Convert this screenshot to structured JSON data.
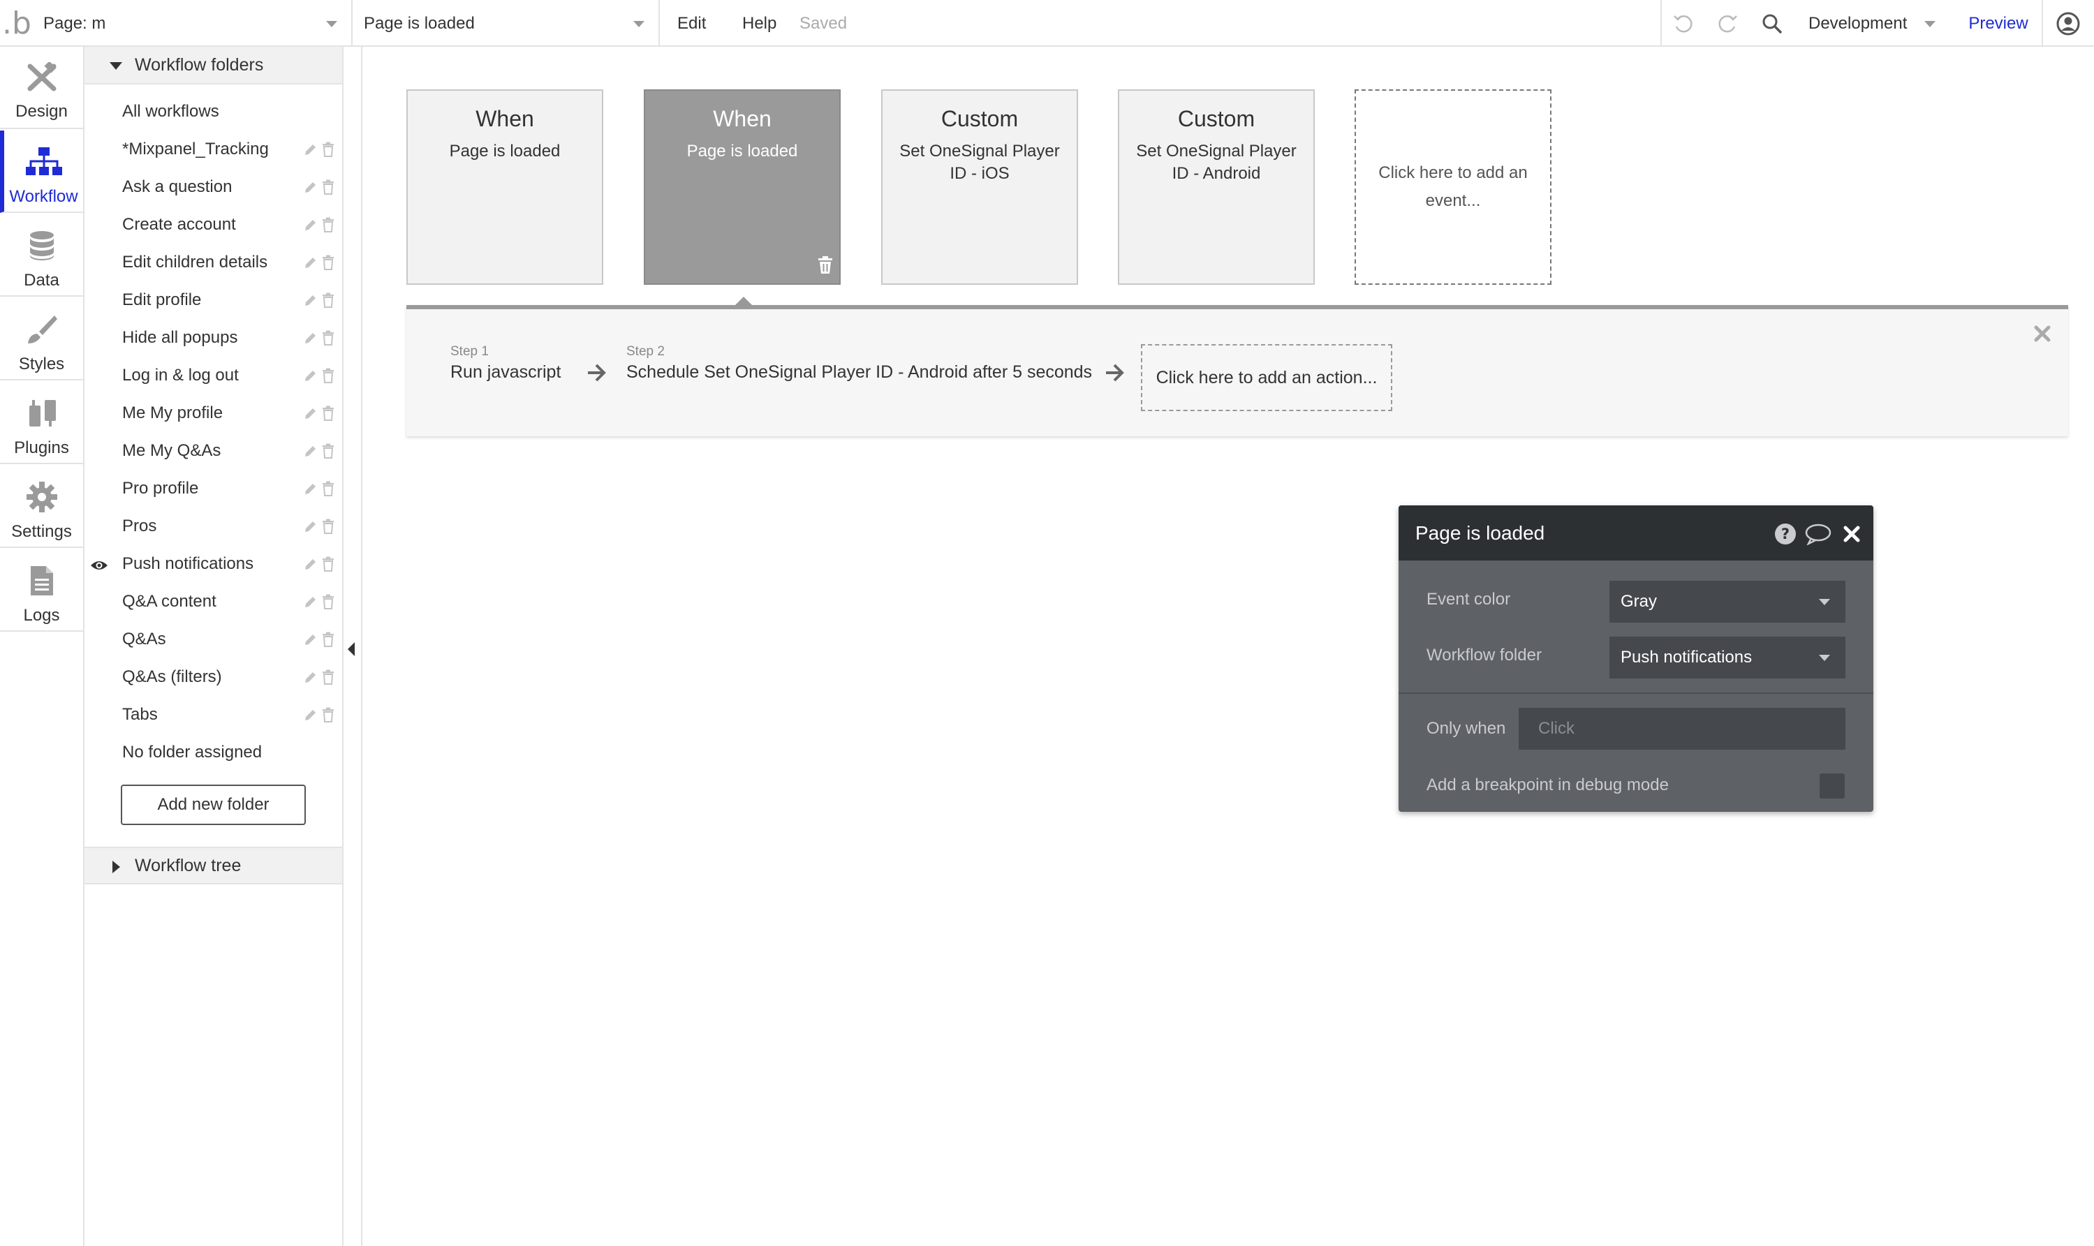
{
  "topbar": {
    "logo": ".b",
    "page_select": "Page: m",
    "event_select": "Page is loaded",
    "menu_edit": "Edit",
    "menu_help": "Help",
    "status": "Saved",
    "environment": "Development",
    "preview": "Preview"
  },
  "leftnav": [
    {
      "label": "Design",
      "icon": "design-icon"
    },
    {
      "label": "Workflow",
      "icon": "workflow-icon",
      "active": true
    },
    {
      "label": "Data",
      "icon": "database-icon"
    },
    {
      "label": "Styles",
      "icon": "brush-icon"
    },
    {
      "label": "Plugins",
      "icon": "plugin-icon"
    },
    {
      "label": "Settings",
      "icon": "gear-icon"
    },
    {
      "label": "Logs",
      "icon": "document-icon"
    }
  ],
  "folders": {
    "header": "Workflow folders",
    "items": [
      {
        "label": "All workflows",
        "actions": false
      },
      {
        "label": "*Mixpanel_Tracking",
        "actions": true
      },
      {
        "label": "Ask a question",
        "actions": true
      },
      {
        "label": "Create account",
        "actions": true
      },
      {
        "label": "Edit children details",
        "actions": true
      },
      {
        "label": "Edit profile",
        "actions": true
      },
      {
        "label": "Hide all popups",
        "actions": true
      },
      {
        "label": "Log in & log out",
        "actions": true
      },
      {
        "label": "Me My profile",
        "actions": true
      },
      {
        "label": "Me My Q&As",
        "actions": true
      },
      {
        "label": "Pro profile",
        "actions": true
      },
      {
        "label": "Pros",
        "actions": true
      },
      {
        "label": "Push notifications",
        "actions": true,
        "visible_eye": true
      },
      {
        "label": "Q&A content",
        "actions": true
      },
      {
        "label": "Q&As",
        "actions": true
      },
      {
        "label": "Q&As (filters)",
        "actions": true
      },
      {
        "label": "Tabs",
        "actions": true
      },
      {
        "label": "No folder assigned",
        "actions": false
      }
    ],
    "add_button": "Add new folder",
    "tree_label": "Workflow tree"
  },
  "events": [
    {
      "title": "When",
      "subtitle": "Page is loaded",
      "selected": false
    },
    {
      "title": "When",
      "subtitle": "Page is loaded",
      "selected": true
    },
    {
      "title": "Custom",
      "subtitle": "Set OneSignal Player ID - iOS",
      "selected": false
    },
    {
      "title": "Custom",
      "subtitle": "Set OneSignal Player ID - Android",
      "selected": false
    }
  ],
  "add_event": "Click here to add an event...",
  "steps": [
    {
      "num": "Step 1",
      "label": "Run javascript"
    },
    {
      "num": "Step 2",
      "label": "Schedule Set OneSignal Player ID - Android after 5 seconds"
    }
  ],
  "add_action": "Click here to add an action...",
  "popup": {
    "title": "Page is loaded",
    "event_color_label": "Event color",
    "event_color_value": "Gray",
    "folder_label": "Workflow folder",
    "folder_value": "Push notifications",
    "only_when_label": "Only when",
    "only_when_placeholder": "Click",
    "breakpoint_label": "Add a breakpoint in debug mode"
  },
  "colors": {
    "accent": "#1f2bd4",
    "selected_event": "#9a9a9a",
    "popup_bg": "#5e6166",
    "popup_header": "#2d3033"
  }
}
